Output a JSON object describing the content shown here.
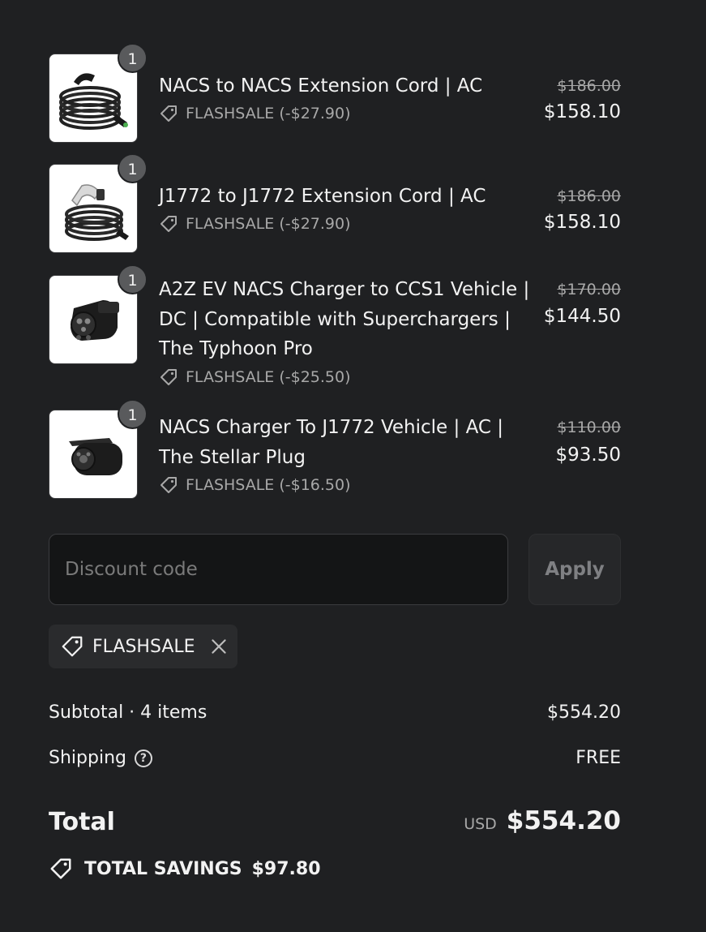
{
  "items": [
    {
      "quantity": "1",
      "name": "NACS to NACS Extension Cord | AC",
      "discount": "FLASHSALE (-$27.90)",
      "original_price": "$186.00",
      "price": "$158.10",
      "image_icon": "nacs-extension-cord-icon"
    },
    {
      "quantity": "1",
      "name": "J1772 to J1772 Extension Cord | AC",
      "discount": "FLASHSALE (-$27.90)",
      "original_price": "$186.00",
      "price": "$158.10",
      "image_icon": "j1772-extension-cord-icon"
    },
    {
      "quantity": "1",
      "name": "A2Z EV NACS Charger to CCS1 Vehicle | DC | Compatible with Superchargers | The Typhoon Pro",
      "discount": "FLASHSALE (-$25.50)",
      "original_price": "$170.00",
      "price": "$144.50",
      "image_icon": "typhoon-pro-adapter-icon"
    },
    {
      "quantity": "1",
      "name": "NACS Charger To J1772 Vehicle | AC | The Stellar Plug",
      "discount": "FLASHSALE (-$16.50)",
      "original_price": "$110.00",
      "price": "$93.50",
      "image_icon": "stellar-plug-adapter-icon"
    }
  ],
  "discount_form": {
    "placeholder": "Discount code",
    "value": "",
    "apply_label": "Apply"
  },
  "applied_code": {
    "label": "FLASHSALE"
  },
  "summary": {
    "subtotal_label": "Subtotal · 4 items",
    "subtotal_value": "$554.20",
    "shipping_label": "Shipping",
    "shipping_value": "FREE",
    "total_label": "Total",
    "currency": "USD",
    "total_value": "$554.20",
    "savings_label": "TOTAL SAVINGS",
    "savings_value": "$97.80"
  },
  "colors": {
    "background": "#1f2022",
    "text": "#f2f2f2",
    "muted": "#a8a8a8",
    "badge": "#595a5c"
  }
}
